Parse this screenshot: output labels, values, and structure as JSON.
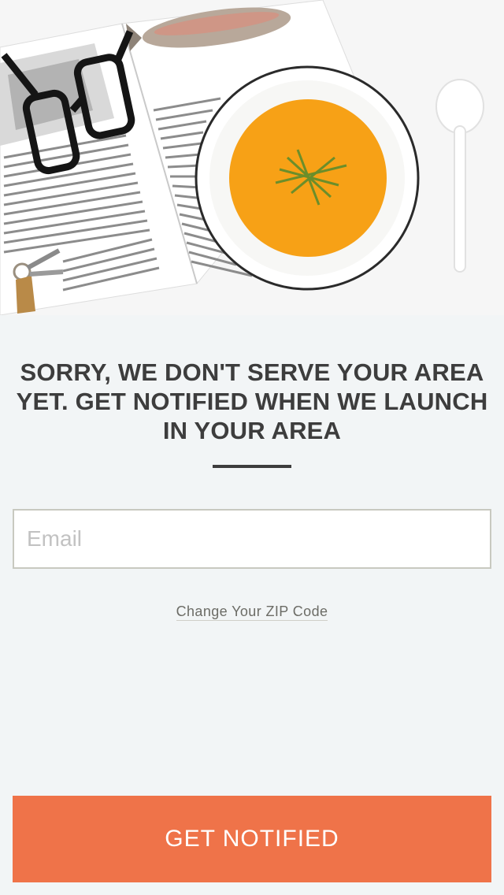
{
  "hero": {
    "image_icon": "soup-bowl-with-magazine-glasses-keys-spoon",
    "colors": {
      "soup": "#f7a116",
      "page": "#ffffff",
      "rim": "#2a2a2a",
      "background": "#f6f6f6"
    }
  },
  "message": {
    "headline": "SORRY, WE DON'T SERVE YOUR AREA YET.  GET NOTIFIED WHEN WE LAUNCH IN YOUR AREA"
  },
  "form": {
    "email_placeholder": "Email",
    "email_value": ""
  },
  "links": {
    "change_zip": "Change Your ZIP Code"
  },
  "actions": {
    "notify_label": "GET NOTIFIED",
    "accent_color": "#ef7349"
  }
}
